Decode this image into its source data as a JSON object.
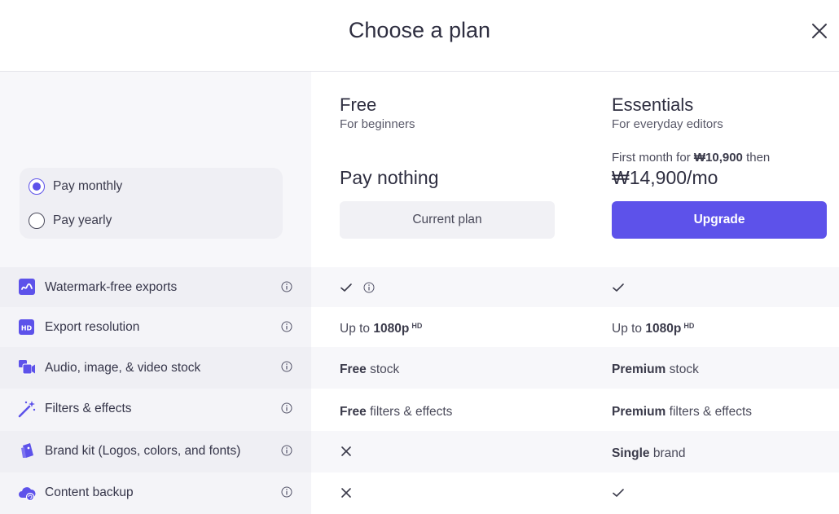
{
  "header": {
    "title": "Choose a plan"
  },
  "billing": {
    "options": [
      {
        "label": "Pay monthly",
        "selected": true
      },
      {
        "label": "Pay yearly",
        "selected": false
      }
    ]
  },
  "plans": [
    {
      "name": "Free",
      "subtitle": "For beginners",
      "price": "Pay nothing",
      "button": "Current plan"
    },
    {
      "name": "Essentials",
      "subtitle": "For everyday editors",
      "promo_prefix": "First month for",
      "promo_amount": "₩10,900",
      "promo_suffix": "then",
      "price": "₩14,900/mo",
      "button": "Upgrade"
    }
  ],
  "features": [
    {
      "label": "Watermark-free exports",
      "icon": "watermark-icon",
      "free": "check",
      "essentials": "check"
    },
    {
      "label": "Export resolution",
      "icon": "hd-icon",
      "free_prefix": "Up to",
      "free_bold": "1080p",
      "free_sup": "HD",
      "ess_prefix": "Up to",
      "ess_bold": "1080p",
      "ess_sup": "HD"
    },
    {
      "label": "Audio, image, & video stock",
      "icon": "media-stock-icon",
      "free_bold": "Free",
      "free_rest": "stock",
      "ess_bold": "Premium",
      "ess_rest": "stock"
    },
    {
      "label": "Filters & effects",
      "icon": "magic-wand-icon",
      "free_bold": "Free",
      "free_rest": "filters & effects",
      "ess_bold": "Premium",
      "ess_rest": "filters & effects"
    },
    {
      "label": "Brand kit (Logos, colors, and fonts)",
      "icon": "brand-kit-icon",
      "free": "cross",
      "ess_bold": "Single",
      "ess_rest": "brand"
    },
    {
      "label": "Content backup",
      "icon": "cloud-backup-icon",
      "free": "cross",
      "essentials": "check"
    }
  ],
  "colors": {
    "accent": "#5d52ea",
    "text": "#36364a",
    "panel": "#f7f7fa"
  }
}
